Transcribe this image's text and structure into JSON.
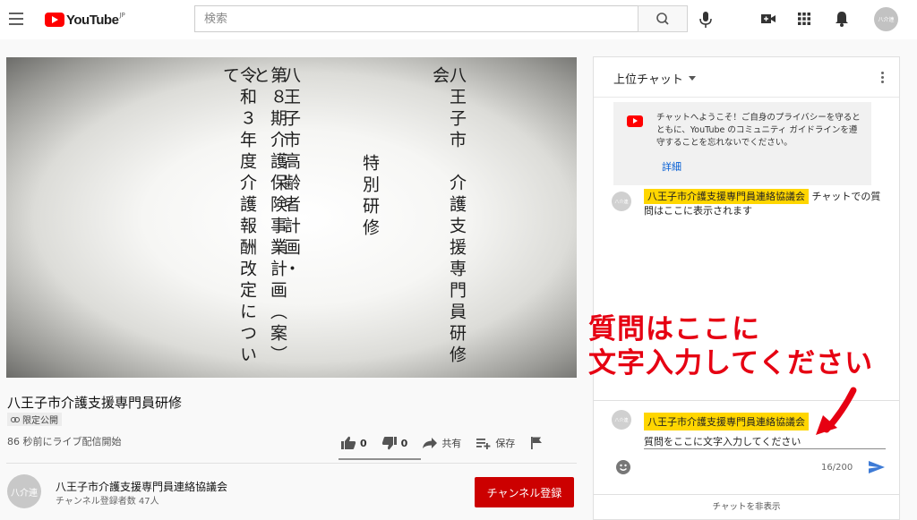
{
  "header": {
    "logo_text": "YouTube",
    "region": "JP",
    "search_placeholder": "検索",
    "avatar_text": "八介連"
  },
  "video": {
    "slide_columns": [
      "八王子市　介護支援専門員研修会",
      "特別研修",
      "八王子市高齢者計画・",
      "第８期介護保険事業計画（案）と",
      "令和３年度介護報酬改定について"
    ],
    "title": "八王子市介護支援専門員研修",
    "visibility": "限定公開",
    "live_started": "86 秒前にライブ配信開始",
    "like_count": "0",
    "dislike_count": "0",
    "share_label": "共有",
    "save_label": "保存"
  },
  "channel": {
    "avatar_text": "八介連",
    "name": "八王子市介護支援専門員連絡協議会",
    "subscribers": "チャンネル登録者数 47人",
    "subscribe_label": "チャンネル登録"
  },
  "chat": {
    "mode_label": "上位チャット",
    "welcome_text": "チャットへようこそ！ご自身のプライバシーを守るとともに、YouTube のコミュニティ ガイドラインを遵守することを忘れないでください。",
    "welcome_link": "詳細",
    "message_avatar_text": "八介連",
    "message_author": "八王子市介護支援専門員連絡協議会",
    "message_text": "チャットでの質問はここに表示されます",
    "input_author": "八王子市介護支援専門員連絡協議会",
    "input_value": "質問をここに文字入力してください",
    "char_counter": "16/200",
    "hide_label": "チャットを非表示"
  },
  "annotation": {
    "line1": "質問はここに",
    "line2": "文字入力してください",
    "color": "#e60012"
  },
  "colors": {
    "brand_red": "#ff0000",
    "subscribe_red": "#cc0000",
    "author_highlight": "#ffd600",
    "link_blue": "#065fd4"
  }
}
